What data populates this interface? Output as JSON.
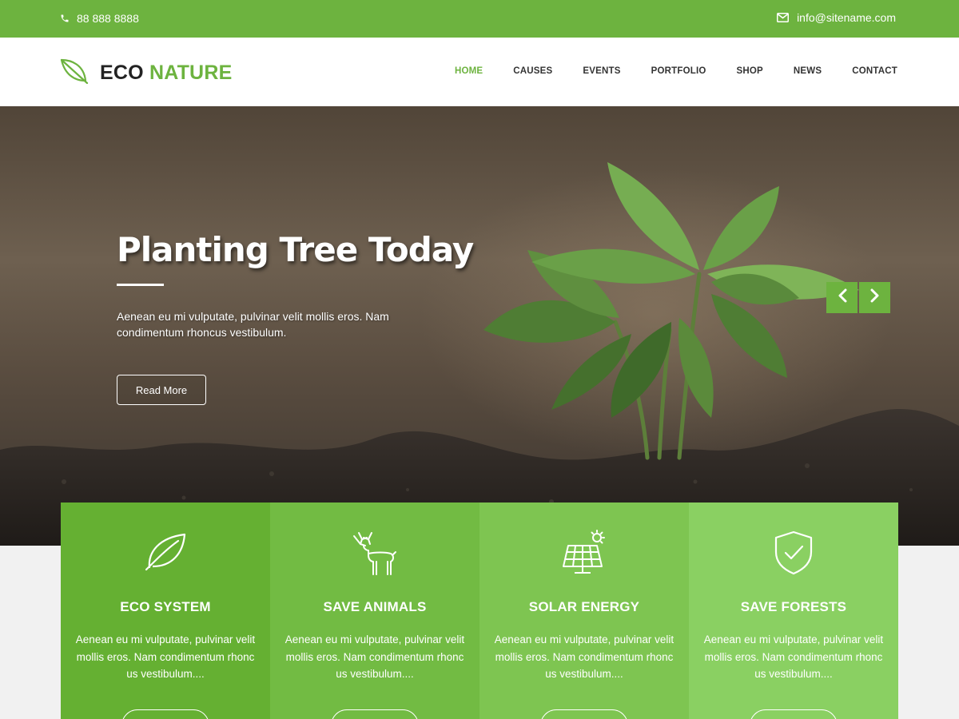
{
  "topbar": {
    "phone": "88 888 8888",
    "email": "info@sitename.com",
    "background": "#6db33f"
  },
  "logo": {
    "word1": "ECO",
    "word2": "NATURE",
    "icon": "leaf-icon"
  },
  "nav": {
    "items": [
      {
        "label": "HOME",
        "active": true
      },
      {
        "label": "CAUSES"
      },
      {
        "label": "EVENTS"
      },
      {
        "label": "PORTFOLIO"
      },
      {
        "label": "SHOP"
      },
      {
        "label": "NEWS"
      },
      {
        "label": "CONTACT"
      }
    ]
  },
  "hero": {
    "title": "Planting Tree Today",
    "text": "Aenean eu mi vulputate, pulvinar velit mollis eros. Nam condimentum rhoncus vestibulum.",
    "button": "Read More",
    "prev_icon": "chevron-left-icon",
    "next_icon": "chevron-right-icon"
  },
  "features": [
    {
      "icon": "leaf-icon",
      "title": "ECO SYSTEM",
      "text": "Aenean eu mi vulputate, pulvinar velit mollis eros. Nam condimentum rhonc us vestibulum....",
      "color": "#65b032"
    },
    {
      "icon": "deer-icon",
      "title": "SAVE ANIMALS",
      "text": "Aenean eu mi vulputate, pulvinar velit mollis eros. Nam condimentum rhonc us vestibulum....",
      "color": "#72bb43"
    },
    {
      "icon": "solar-panel-icon",
      "title": "SOLAR ENERGY",
      "text": "Aenean eu mi vulputate, pulvinar velit mollis eros. Nam condimentum rhonc us vestibulum....",
      "color": "#7ec551"
    },
    {
      "icon": "shield-check-icon",
      "title": "SAVE FORESTS",
      "text": "Aenean eu mi vulputate, pulvinar velit mollis eros. Nam condimentum rhonc us vestibulum....",
      "color": "#8ad062"
    }
  ]
}
